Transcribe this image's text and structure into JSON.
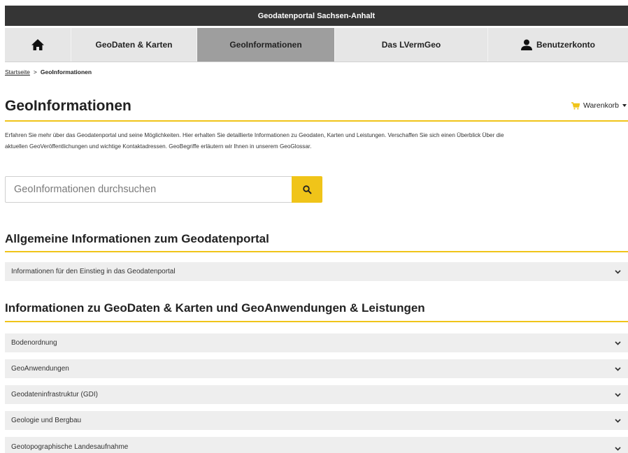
{
  "header": {
    "site_title": "Geodatenportal Sachsen-Anhalt"
  },
  "nav": {
    "home_icon": "home-icon",
    "items": [
      {
        "label": "GeoDaten & Karten"
      },
      {
        "label": "GeoInformationen"
      },
      {
        "label": "Das LVermGeo"
      },
      {
        "label": "Benutzerkonto"
      }
    ],
    "active": "GeoInformationen",
    "active_color": "#9e9e9e"
  },
  "breadcrumb": {
    "home": "Startseite",
    "separator": ">",
    "current": "GeoInformationen"
  },
  "page": {
    "title": "GeoInformationen",
    "cart_label": "Warenkorb"
  },
  "intro": {
    "line1": "Erfahren Sie mehr über das Geodatenportal und seine Möglichkeiten. Hier erhalten Sie detaillierte Informationen zu Geodaten, Karten und Leistungen. Verschaffen Sie sich einen Überblick Über die",
    "line2": "aktuellen GeoVeröffentlichungen und wichtige Kontaktadressen. GeoBegriffe erläutern wir Ihnen in unserem GeoGlossar."
  },
  "search": {
    "placeholder": "GeoInformationen durchsuchen",
    "value": ""
  },
  "sections": [
    {
      "title": "Allgemeine Informationen zum Geodatenportal",
      "items": [
        "Informationen für den Einstieg in das Geodatenportal"
      ]
    },
    {
      "title": "Informationen zu GeoDaten & Karten und GeoAnwendungen & Leistungen",
      "items": [
        "Bodenordnung",
        "GeoAnwendungen",
        "Geodateninfrastruktur (GDI)",
        "Geologie und Bergbau",
        "Geotopographische Landesaufnahme"
      ]
    }
  ],
  "colors": {
    "accent": "#f0c419",
    "topbar": "#353535",
    "nav_bg": "#e6e6e6",
    "accordion_bg": "#eeeeee"
  }
}
